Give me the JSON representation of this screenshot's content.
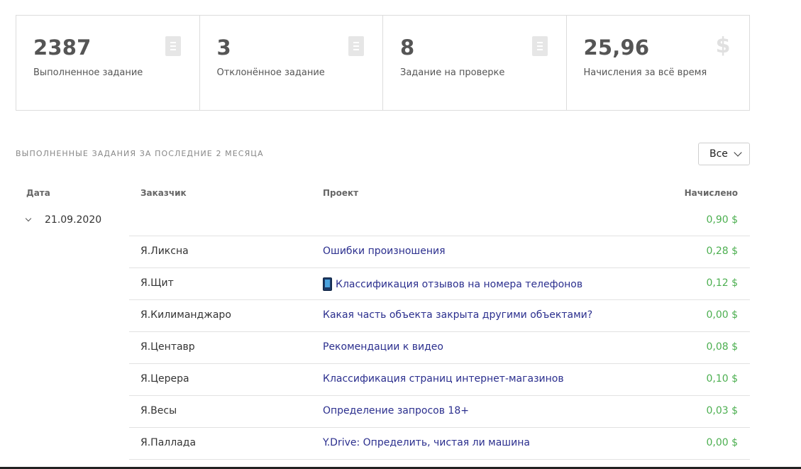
{
  "stats": [
    {
      "value": "2387",
      "label": "Выполненное задание",
      "icon": "document-icon"
    },
    {
      "value": "3",
      "label": "Отклонённое задание",
      "icon": "document-icon"
    },
    {
      "value": "8",
      "label": "Задание на проверке",
      "icon": "document-icon"
    },
    {
      "value": "25,96",
      "label": "Начисления за всё время",
      "icon": "dollar-icon",
      "icon_glyph": "$"
    }
  ],
  "section": {
    "title": "ВЫПОЛНЕННЫЕ ЗАДАНИЯ ЗА ПОСЛЕДНИЕ 2 МЕСЯЦА",
    "filter_value": "Все"
  },
  "table": {
    "headers": {
      "date": "Дата",
      "client": "Заказчик",
      "project": "Проект",
      "amount": "Начислено"
    },
    "groups": [
      {
        "date": "21.09.2020",
        "total": "0,90 $",
        "rows": [
          {
            "client": "Я.Ликсна",
            "project": "Ошибки произношения",
            "amount": "0,28 $"
          },
          {
            "client": "Я.Щит",
            "project": "Классификация отзывов на номера телефонов",
            "amount": "0,12 $",
            "icon": "phone-icon"
          },
          {
            "client": "Я.Килиманджаро",
            "project": "Какая часть объекта закрыта другими объектами?",
            "amount": "0,00 $"
          },
          {
            "client": "Я.Центавр",
            "project": "Рекомендации к видео",
            "amount": "0,08 $"
          },
          {
            "client": "Я.Церера",
            "project": "Классификация страниц интернет-магазинов",
            "amount": "0,10 $"
          },
          {
            "client": "Я.Весы",
            "project": "Определение запросов 18+",
            "amount": "0,03 $"
          },
          {
            "client": "Я.Паллада",
            "project": "Y.Drive: Определить, чистая ли машина",
            "amount": "0,00 $"
          }
        ]
      }
    ]
  },
  "colors": {
    "amount": "#4caf50",
    "link": "#2b2f8e",
    "border": "#dcdcdc"
  }
}
